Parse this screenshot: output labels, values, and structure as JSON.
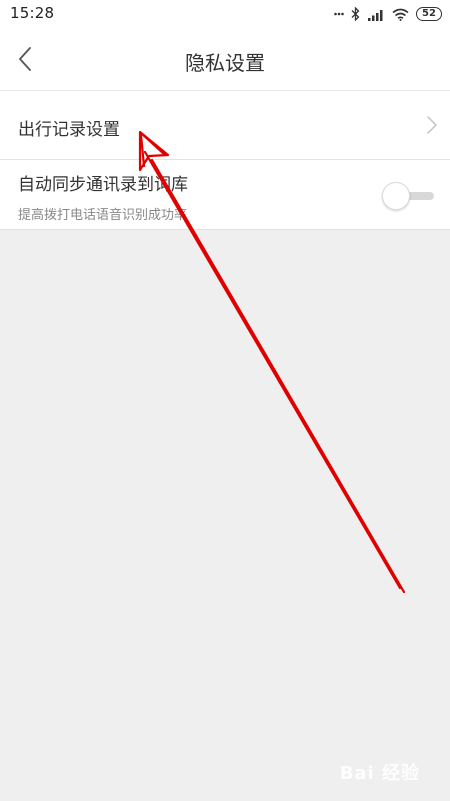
{
  "status_bar": {
    "time": "15:28",
    "battery": "52",
    "icons": [
      "dots-icon",
      "bluetooth-icon",
      "signal-icon",
      "wifi-icon",
      "battery-icon"
    ]
  },
  "nav": {
    "title": "隐私设置",
    "back_icon": "chevron-left-icon"
  },
  "settings": {
    "travel_record": {
      "label": "出行记录设置",
      "icon": "chevron-right-icon"
    },
    "sync_contacts": {
      "label": "自动同步通讯录到词库",
      "description": "提高拨打电话语音识别成功率",
      "enabled": false
    }
  },
  "watermark": "Bai 经验",
  "colors": {
    "background": "#efeff0",
    "annotation_arrow": "#e00000"
  }
}
